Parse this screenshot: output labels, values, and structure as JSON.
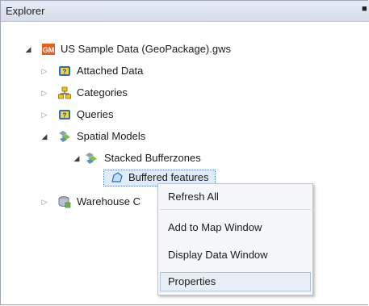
{
  "panel": {
    "title": "Explorer",
    "pin_icon": "pin-icon"
  },
  "tree": [
    {
      "label": "US Sample Data (GeoPackage).gws",
      "icon": "gm-icon",
      "expanded": true
    },
    {
      "label": "Attached Data",
      "icon": "attached-data-icon",
      "expanded": false
    },
    {
      "label": "Categories",
      "icon": "categories-icon",
      "expanded": false
    },
    {
      "label": "Queries",
      "icon": "queries-icon",
      "expanded": false
    },
    {
      "label": "Spatial Models",
      "icon": "spatial-model-icon",
      "expanded": true
    },
    {
      "label": "Stacked Bufferzones",
      "icon": "spatial-model-icon",
      "expanded": true
    },
    {
      "label": "Buffered features",
      "icon": "polygon-layer-icon",
      "selected": true
    },
    {
      "label": "Warehouse C",
      "icon": "warehouse-icon",
      "expanded": false
    }
  ],
  "context_menu": {
    "items": [
      "Refresh All",
      "Add to Map Window",
      "Display Data Window",
      "Properties"
    ],
    "hovered": "Properties"
  },
  "colors": {
    "selection": "#e1ecf9",
    "gm_badge": "#e8601c",
    "spatial_model": "#7fc242"
  }
}
